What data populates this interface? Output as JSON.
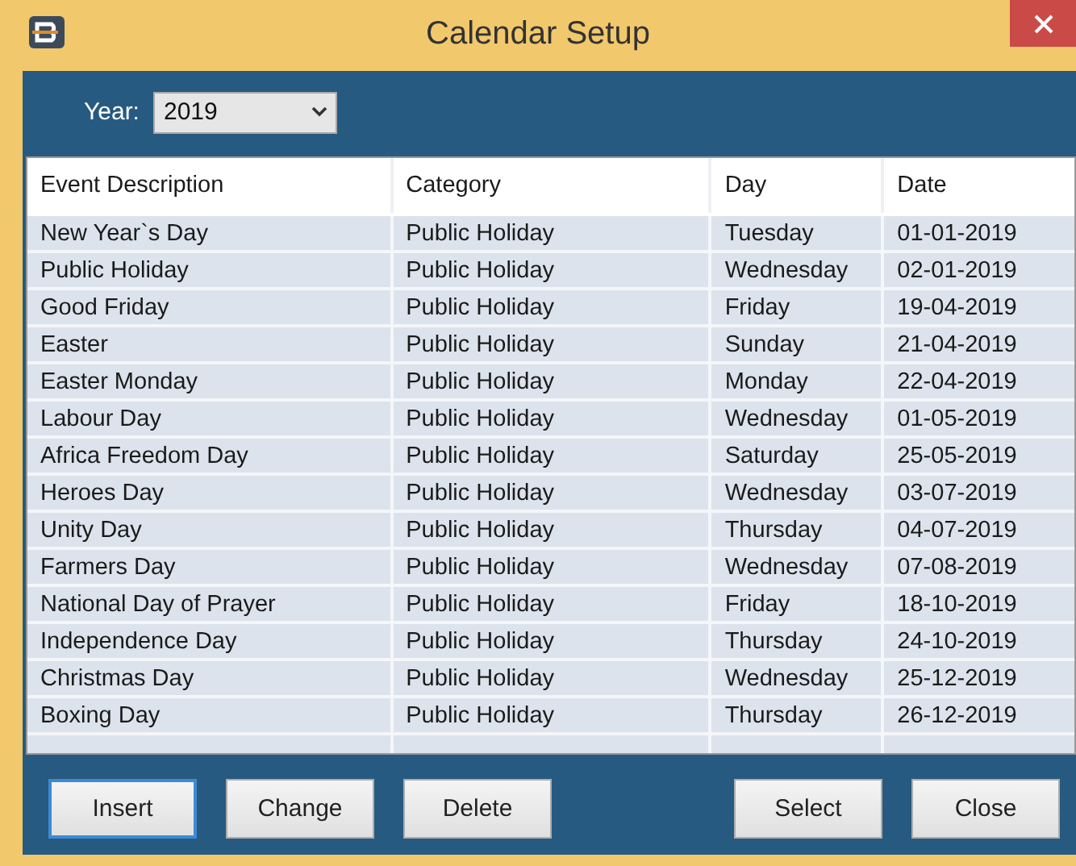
{
  "window": {
    "title": "Calendar Setup"
  },
  "year": {
    "label": "Year:",
    "value": "2019"
  },
  "table": {
    "columns": [
      "Event Description",
      "Category",
      "Day",
      "Date"
    ],
    "rows": [
      [
        "New Year`s Day",
        "Public Holiday",
        "Tuesday",
        "01-01-2019"
      ],
      [
        "Public Holiday",
        "Public Holiday",
        "Wednesday",
        "02-01-2019"
      ],
      [
        "Good Friday",
        "Public Holiday",
        "Friday",
        "19-04-2019"
      ],
      [
        "Easter",
        "Public Holiday",
        "Sunday",
        "21-04-2019"
      ],
      [
        "Easter Monday",
        "Public Holiday",
        "Monday",
        "22-04-2019"
      ],
      [
        "Labour Day",
        "Public Holiday",
        "Wednesday",
        "01-05-2019"
      ],
      [
        "Africa Freedom Day",
        "Public Holiday",
        "Saturday",
        "25-05-2019"
      ],
      [
        "Heroes Day",
        "Public Holiday",
        "Wednesday",
        "03-07-2019"
      ],
      [
        "Unity Day",
        "Public Holiday",
        "Thursday",
        "04-07-2019"
      ],
      [
        "Farmers Day",
        "Public Holiday",
        "Wednesday",
        "07-08-2019"
      ],
      [
        "National Day of Prayer",
        "Public Holiday",
        "Friday",
        "18-10-2019"
      ],
      [
        "Independence Day",
        "Public Holiday",
        "Thursday",
        "24-10-2019"
      ],
      [
        "Christmas Day",
        "Public Holiday",
        "Wednesday",
        "25-12-2019"
      ],
      [
        "Boxing Day",
        "Public Holiday",
        "Thursday",
        "26-12-2019"
      ]
    ]
  },
  "buttons_left": [
    {
      "label": "Insert",
      "focused": true
    },
    {
      "label": "Change",
      "focused": false
    },
    {
      "label": "Delete",
      "focused": false
    }
  ],
  "buttons_right": [
    {
      "label": "Select",
      "focused": false
    },
    {
      "label": "Close",
      "focused": false
    }
  ]
}
